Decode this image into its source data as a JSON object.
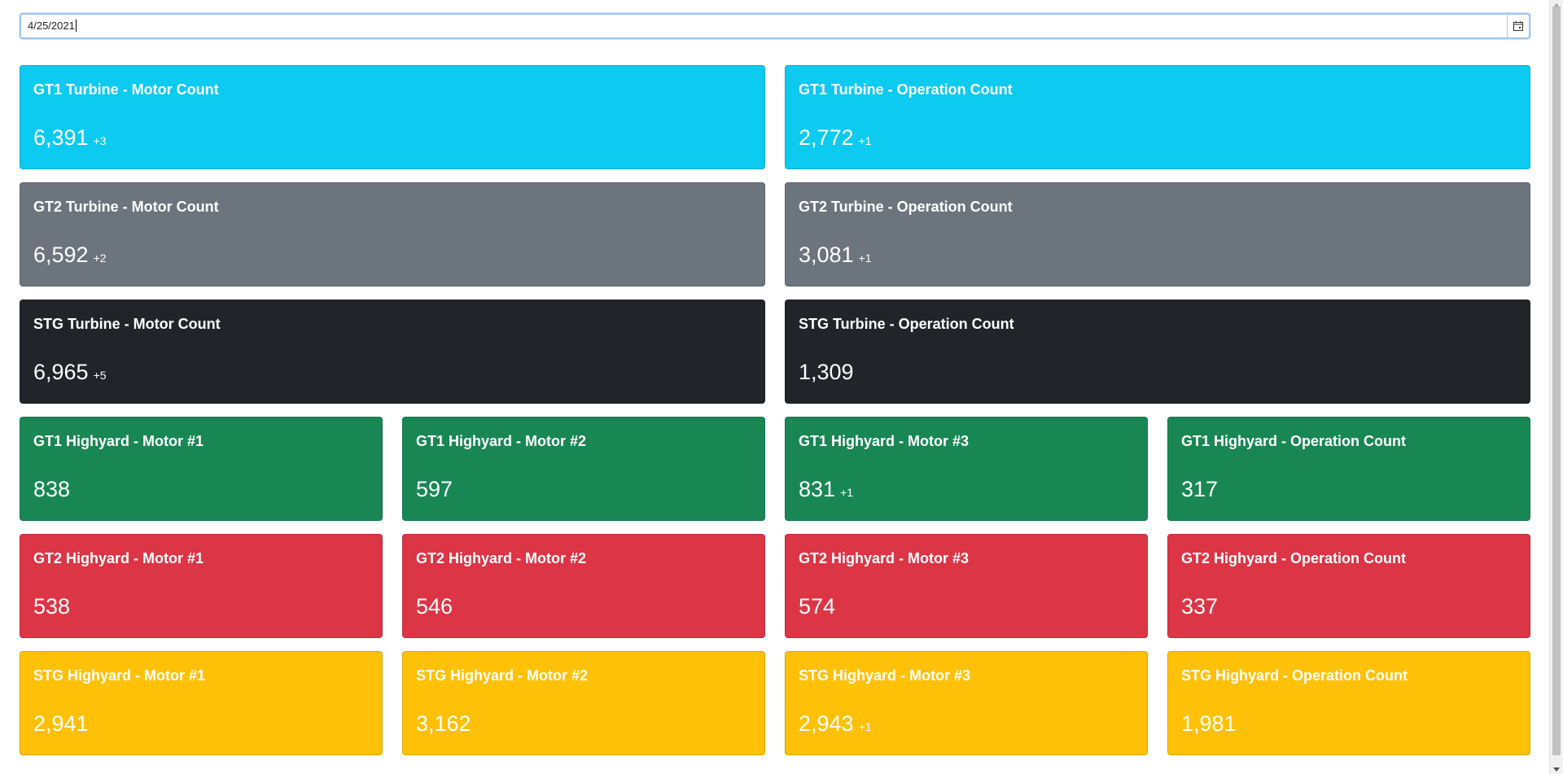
{
  "date_input": {
    "value": "4/25/2021"
  },
  "colors": {
    "info": "#0dcaf0",
    "secondary": "#6c757d",
    "dark": "#212529",
    "success": "#198754",
    "danger": "#dc3545",
    "warning": "#ffc107"
  },
  "rows": [
    [
      {
        "title": "GT1 Turbine - Motor Count",
        "value": "6,391",
        "delta": "+3",
        "color": "info"
      },
      {
        "title": "GT1 Turbine - Operation Count",
        "value": "2,772",
        "delta": "+1",
        "color": "info"
      }
    ],
    [
      {
        "title": "GT2 Turbine - Motor Count",
        "value": "6,592",
        "delta": "+2",
        "color": "secondary"
      },
      {
        "title": "GT2 Turbine - Operation Count",
        "value": "3,081",
        "delta": "+1",
        "color": "secondary"
      }
    ],
    [
      {
        "title": "STG Turbine - Motor Count",
        "value": "6,965",
        "delta": "+5",
        "color": "dark"
      },
      {
        "title": "STG Turbine - Operation Count",
        "value": "1,309",
        "delta": "",
        "color": "dark"
      }
    ],
    [
      {
        "title": "GT1 Highyard - Motor #1",
        "value": "838",
        "delta": "",
        "color": "success"
      },
      {
        "title": "GT1 Highyard - Motor #2",
        "value": "597",
        "delta": "",
        "color": "success"
      },
      {
        "title": "GT1 Highyard - Motor #3",
        "value": "831",
        "delta": "+1",
        "color": "success"
      },
      {
        "title": "GT1 Highyard - Operation Count",
        "value": "317",
        "delta": "",
        "color": "success"
      }
    ],
    [
      {
        "title": "GT2 Highyard - Motor #1",
        "value": "538",
        "delta": "",
        "color": "danger"
      },
      {
        "title": "GT2 Highyard - Motor #2",
        "value": "546",
        "delta": "",
        "color": "danger"
      },
      {
        "title": "GT2 Highyard - Motor #3",
        "value": "574",
        "delta": "",
        "color": "danger"
      },
      {
        "title": "GT2 Highyard - Operation Count",
        "value": "337",
        "delta": "",
        "color": "danger"
      }
    ],
    [
      {
        "title": "STG Highyard - Motor #1",
        "value": "2,941",
        "delta": "",
        "color": "warning"
      },
      {
        "title": "STG Highyard - Motor #2",
        "value": "3,162",
        "delta": "",
        "color": "warning"
      },
      {
        "title": "STG Highyard - Motor #3",
        "value": "2,943",
        "delta": "+1",
        "color": "warning"
      },
      {
        "title": "STG Highyard - Operation Count",
        "value": "1,981",
        "delta": "",
        "color": "warning"
      }
    ]
  ]
}
